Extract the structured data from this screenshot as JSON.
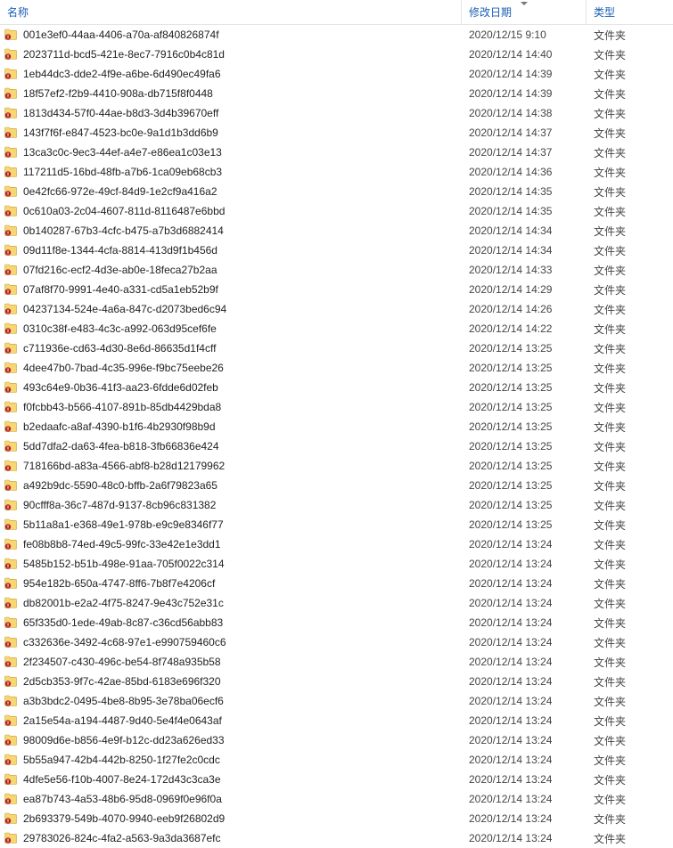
{
  "columns": {
    "name": "名称",
    "date": "修改日期",
    "type": "类型"
  },
  "type_label": "文件夹",
  "rows": [
    {
      "name": "001e3ef0-44aa-4406-a70a-af840826874f",
      "date": "2020/12/15 9:10"
    },
    {
      "name": "2023711d-bcd5-421e-8ec7-7916c0b4c81d",
      "date": "2020/12/14 14:40"
    },
    {
      "name": "1eb44dc3-dde2-4f9e-a6be-6d490ec49fa6",
      "date": "2020/12/14 14:39"
    },
    {
      "name": "18f57ef2-f2b9-4410-908a-db715f8f0448",
      "date": "2020/12/14 14:39"
    },
    {
      "name": "1813d434-57f0-44ae-b8d3-3d4b39670eff",
      "date": "2020/12/14 14:38"
    },
    {
      "name": "143f7f6f-e847-4523-bc0e-9a1d1b3dd6b9",
      "date": "2020/12/14 14:37"
    },
    {
      "name": "13ca3c0c-9ec3-44ef-a4e7-e86ea1c03e13",
      "date": "2020/12/14 14:37"
    },
    {
      "name": "117211d5-16bd-48fb-a7b6-1ca09eb68cb3",
      "date": "2020/12/14 14:36"
    },
    {
      "name": "0e42fc66-972e-49cf-84d9-1e2cf9a416a2",
      "date": "2020/12/14 14:35"
    },
    {
      "name": "0c610a03-2c04-4607-811d-8116487e6bbd",
      "date": "2020/12/14 14:35"
    },
    {
      "name": "0b140287-67b3-4cfc-b475-a7b3d6882414",
      "date": "2020/12/14 14:34"
    },
    {
      "name": "09d11f8e-1344-4cfa-8814-413d9f1b456d",
      "date": "2020/12/14 14:34"
    },
    {
      "name": "07fd216c-ecf2-4d3e-ab0e-18feca27b2aa",
      "date": "2020/12/14 14:33"
    },
    {
      "name": "07af8f70-9991-4e40-a331-cd5a1eb52b9f",
      "date": "2020/12/14 14:29"
    },
    {
      "name": "04237134-524e-4a6a-847c-d2073bed6c94",
      "date": "2020/12/14 14:26"
    },
    {
      "name": "0310c38f-e483-4c3c-a992-063d95cef6fe",
      "date": "2020/12/14 14:22"
    },
    {
      "name": "c711936e-cd63-4d30-8e6d-86635d1f4cff",
      "date": "2020/12/14 13:25"
    },
    {
      "name": "4dee47b0-7bad-4c35-996e-f9bc75eebe26",
      "date": "2020/12/14 13:25"
    },
    {
      "name": "493c64e9-0b36-41f3-aa23-6fdde6d02feb",
      "date": "2020/12/14 13:25"
    },
    {
      "name": "f0fcbb43-b566-4107-891b-85db4429bda8",
      "date": "2020/12/14 13:25"
    },
    {
      "name": "b2edaafc-a8af-4390-b1f6-4b2930f98b9d",
      "date": "2020/12/14 13:25"
    },
    {
      "name": "5dd7dfa2-da63-4fea-b818-3fb66836e424",
      "date": "2020/12/14 13:25"
    },
    {
      "name": "718166bd-a83a-4566-abf8-b28d12179962",
      "date": "2020/12/14 13:25"
    },
    {
      "name": "a492b9dc-5590-48c0-bffb-2a6f79823a65",
      "date": "2020/12/14 13:25"
    },
    {
      "name": "90cfff8a-36c7-487d-9137-8cb96c831382",
      "date": "2020/12/14 13:25"
    },
    {
      "name": "5b11a8a1-e368-49e1-978b-e9c9e8346f77",
      "date": "2020/12/14 13:25"
    },
    {
      "name": "fe08b8b8-74ed-49c5-99fc-33e42e1e3dd1",
      "date": "2020/12/14 13:24"
    },
    {
      "name": "5485b152-b51b-498e-91aa-705f0022c314",
      "date": "2020/12/14 13:24"
    },
    {
      "name": "954e182b-650a-4747-8ff6-7b8f7e4206cf",
      "date": "2020/12/14 13:24"
    },
    {
      "name": "db82001b-e2a2-4f75-8247-9e43c752e31c",
      "date": "2020/12/14 13:24"
    },
    {
      "name": "65f335d0-1ede-49ab-8c87-c36cd56abb83",
      "date": "2020/12/14 13:24"
    },
    {
      "name": "c332636e-3492-4c68-97e1-e990759460c6",
      "date": "2020/12/14 13:24"
    },
    {
      "name": "2f234507-c430-496c-be54-8f748a935b58",
      "date": "2020/12/14 13:24"
    },
    {
      "name": "2d5cb353-9f7c-42ae-85bd-6183e696f320",
      "date": "2020/12/14 13:24"
    },
    {
      "name": "a3b3bdc2-0495-4be8-8b95-3e78ba06ecf6",
      "date": "2020/12/14 13:24"
    },
    {
      "name": "2a15e54a-a194-4487-9d40-5e4f4e0643af",
      "date": "2020/12/14 13:24"
    },
    {
      "name": "98009d6e-b856-4e9f-b12c-dd23a626ed33",
      "date": "2020/12/14 13:24"
    },
    {
      "name": "5b55a947-42b4-442b-8250-1f27fe2c0cdc",
      "date": "2020/12/14 13:24"
    },
    {
      "name": "4dfe5e56-f10b-4007-8e24-172d43c3ca3e",
      "date": "2020/12/14 13:24"
    },
    {
      "name": "ea87b743-4a53-48b6-95d8-0969f0e96f0a",
      "date": "2020/12/14 13:24"
    },
    {
      "name": "2b693379-549b-4070-9940-eeb9f26802d9",
      "date": "2020/12/14 13:24"
    },
    {
      "name": "29783026-824c-4fa2-a563-9a3da3687efc",
      "date": "2020/12/14 13:24"
    }
  ]
}
